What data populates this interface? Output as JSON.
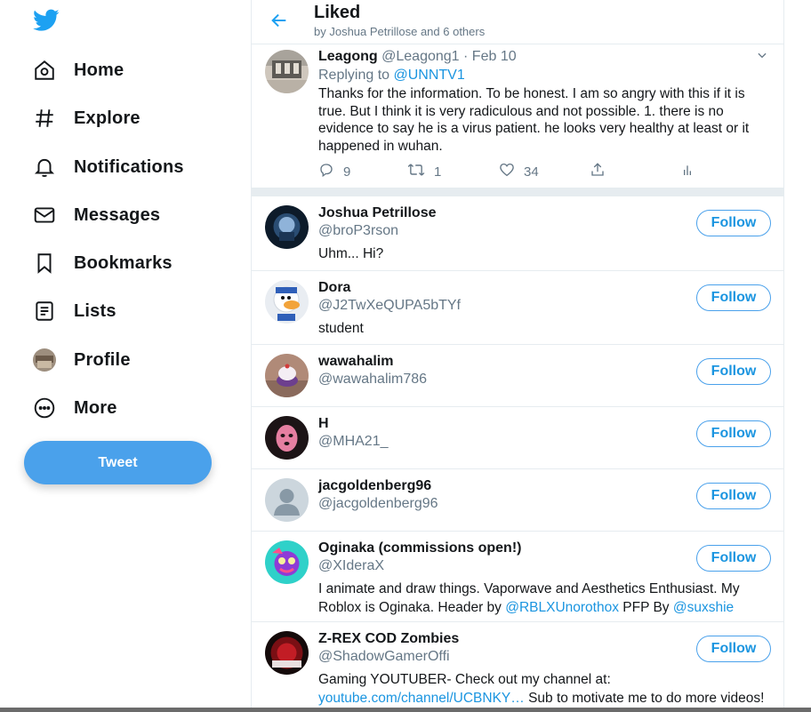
{
  "sidebar": {
    "items": [
      {
        "label": "Home",
        "icon": "home-icon"
      },
      {
        "label": "Explore",
        "icon": "hashtag-icon"
      },
      {
        "label": "Notifications",
        "icon": "bell-icon"
      },
      {
        "label": "Messages",
        "icon": "envelope-icon"
      },
      {
        "label": "Bookmarks",
        "icon": "bookmark-icon"
      },
      {
        "label": "Lists",
        "icon": "list-icon"
      },
      {
        "label": "Profile",
        "icon": "avatar"
      },
      {
        "label": "More",
        "icon": "more-circle-icon"
      }
    ],
    "tweet_button": "Tweet"
  },
  "header": {
    "title": "Liked",
    "subtitle": "by Joshua Petrillose and 6 others"
  },
  "tweet": {
    "name": "Leagong",
    "handle": "@Leagong1",
    "separator": "·",
    "date": "Feb 10",
    "replying_prefix": "Replying to",
    "replying_to": "@UNNTV1",
    "text": "Thanks for the information. To be honest. I am so angry with this if it is true. But I think it is very radiculous and not possible. 1. there is no evidence to say he is a virus patient. he looks very healthy at least or it happened in wuhan.",
    "replies": "9",
    "retweets": "1",
    "likes": "34"
  },
  "users": [
    {
      "name": "Joshua Petrillose",
      "handle": "@broP3rson",
      "bio_parts": [
        "Uhm... Hi?"
      ],
      "follow": "Follow"
    },
    {
      "name": "Dora",
      "handle": "@J2TwXeQUPA5bTYf",
      "bio_parts": [
        "student"
      ],
      "follow": "Follow"
    },
    {
      "name": "wawahalim",
      "handle": "@wawahalim786",
      "bio_parts": [],
      "follow": "Follow"
    },
    {
      "name": "H",
      "handle": "@MHA21_",
      "bio_parts": [],
      "follow": "Follow"
    },
    {
      "name": "jacgoldenberg96",
      "handle": "@jacgoldenberg96",
      "bio_parts": [],
      "follow": "Follow"
    },
    {
      "name": "Oginaka (commissions open!)",
      "handle": "@XIderaX",
      "bio_parts": [
        "I animate and draw things. Vaporwave and Aesthetics Enthusiast. My Roblox is Oginaka. Header by ",
        "@RBLXUnorothox",
        " PFP By ",
        "@suxshie"
      ],
      "follow": "Follow"
    },
    {
      "name": "Z-REX COD Zombies",
      "handle": "@ShadowGamerOffi",
      "bio_parts": [
        "Gaming YOUTUBER- Check out my channel at: ",
        "youtube.com/channel/UCBNKY…",
        " Sub to motivate me to do more videos!"
      ],
      "follow": "Follow"
    }
  ],
  "colors": {
    "accent": "#1da1f2",
    "muted": "#657786",
    "border": "#e6ecf0"
  }
}
